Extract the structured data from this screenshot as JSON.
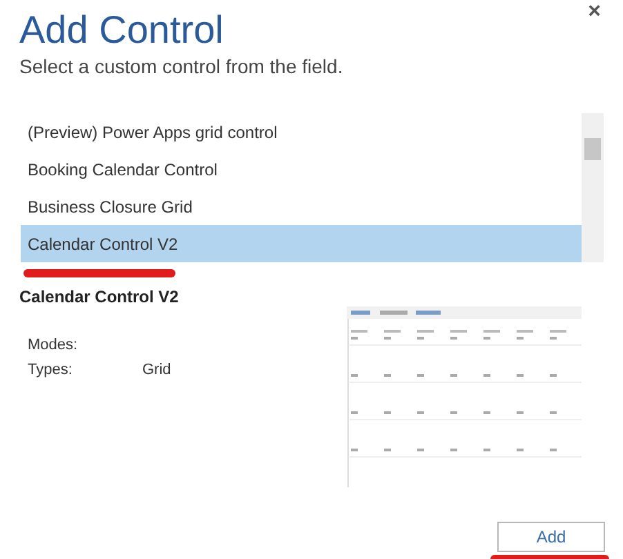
{
  "dialog": {
    "title": "Add Control",
    "subtitle": "Select a custom control from the field.",
    "close": "×"
  },
  "controls": [
    {
      "label": "(Preview) Power Apps grid control",
      "selected": false,
      "underlined": false
    },
    {
      "label": "Booking Calendar Control",
      "selected": false,
      "underlined": false
    },
    {
      "label": "Business Closure Grid",
      "selected": false,
      "underlined": false
    },
    {
      "label": "Calendar Control V2",
      "selected": true,
      "underlined": true
    }
  ],
  "details": {
    "name": "Calendar Control V2",
    "fields": [
      {
        "label": "Modes:"
      },
      {
        "label": "Types:",
        "value": "Grid"
      }
    ]
  },
  "add_button": {
    "label": "Add",
    "underlined": true
  }
}
